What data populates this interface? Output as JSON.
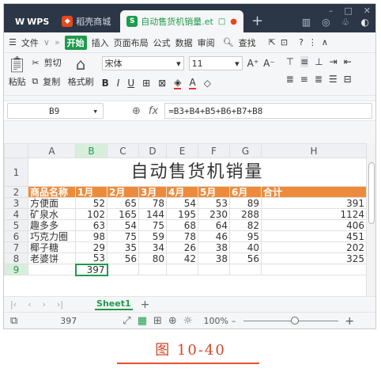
{
  "tabs": {
    "wps_label": "WPS",
    "store_label": "稻壳商城",
    "doc_label": "自动售货机销量.et"
  },
  "menubar": {
    "file": "文件",
    "more": "»",
    "start": "开始",
    "items": [
      "插入",
      "页面布局",
      "公式",
      "数据",
      "审阅"
    ],
    "search": "查找"
  },
  "ribbon": {
    "paste": "粘贴",
    "cut": "剪切",
    "copy": "复制",
    "format_painter": "格式刷",
    "font_name": "宋体",
    "font_size": "11"
  },
  "formula_bar": {
    "cell_ref": "B9",
    "fx": "fx",
    "formula": "=B3+B4+B5+B6+B7+B8"
  },
  "grid": {
    "col_headers": [
      "A",
      "B",
      "C",
      "D",
      "E",
      "F",
      "G",
      "H"
    ],
    "row_headers": [
      "1",
      "2",
      "3",
      "4",
      "5",
      "6",
      "7",
      "8",
      "9"
    ],
    "title": "自动售货机销量",
    "header_row": [
      "商品名称",
      "1月",
      "2月",
      "3月",
      "4月",
      "5月",
      "6月",
      "合计"
    ],
    "rows": [
      {
        "name": "方便面",
        "values": [
          "52",
          "65",
          "78",
          "54",
          "53",
          "89"
        ],
        "total": "391"
      },
      {
        "name": "矿泉水",
        "values": [
          "102",
          "165",
          "144",
          "195",
          "230",
          "288"
        ],
        "total": "1124"
      },
      {
        "name": "趣多多",
        "values": [
          "63",
          "54",
          "75",
          "68",
          "64",
          "82"
        ],
        "total": "406"
      },
      {
        "name": "巧克力圈",
        "values": [
          "98",
          "75",
          "59",
          "78",
          "46",
          "95"
        ],
        "total": "451"
      },
      {
        "name": "椰子糖",
        "values": [
          "29",
          "35",
          "34",
          "26",
          "38",
          "40"
        ],
        "total": "202"
      },
      {
        "name": "老婆饼",
        "values": [
          "53",
          "56",
          "80",
          "42",
          "38",
          "56"
        ],
        "total": "325"
      }
    ],
    "b9_value": "397"
  },
  "sheet_tab": "Sheet1",
  "status": {
    "count": "397",
    "zoom": "100%"
  },
  "caption": "图 10-40"
}
